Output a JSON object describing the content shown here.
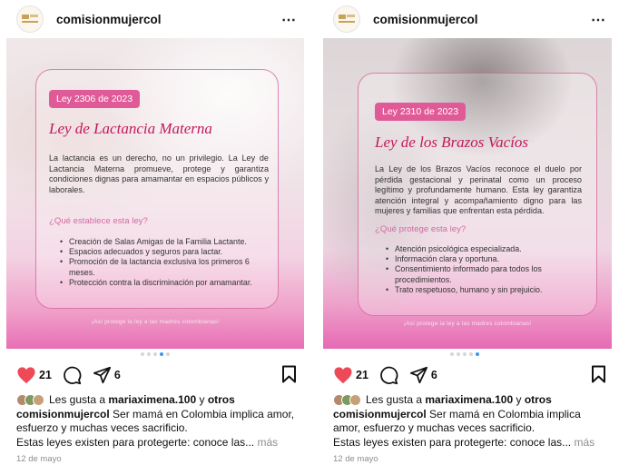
{
  "posts": [
    {
      "username": "comisionmujercol",
      "more_icon": "⋯",
      "card": {
        "badge": "Ley 2306 de 2023",
        "title": "Ley de Lactancia Materna",
        "description": "La lactancia es un derecho, no un privilegio. La Ley de Lactancia Materna promueve, protege y garantiza condiciones dignas para amamantar en espacios públicos y laborales.",
        "question": "¿Qué establece esta ley?",
        "items": [
          "Creación de Salas Amigas de la Familia Lactante.",
          "Espacios adecuados y seguros para lactar.",
          "Promoción de la lactancia exclusiva los primeros 6 meses.",
          "Protección contra la discriminación por amamantar."
        ],
        "footer": "¡Así protege la ley a las madres colombianas!"
      },
      "dots": {
        "total": 6,
        "active": 4
      },
      "likes_count": "21",
      "shares_count": "6",
      "liked_by_prefix": "Les gusta a",
      "liked_by_user": "mariaximena.100",
      "liked_by_and": "y",
      "liked_by_others": "otros",
      "caption_user": "comisionmujercol",
      "caption_text": "Ser mamá en Colombia implica amor, esfuerzo y muchas veces sacrificio.",
      "caption_line2": "Estas leyes existen para protegerte: conoce las...",
      "more_label": "más",
      "date": "12 de mayo"
    },
    {
      "username": "comisionmujercol",
      "more_icon": "⋯",
      "card": {
        "badge": "Ley 2310 de 2023",
        "title": "Ley de los Brazos Vacíos",
        "description": "La Ley de los Brazos Vacíos reconoce el duelo por pérdida gestacional y perinatal como un proceso legítimo y profundamente humano. Esta ley garantiza atención integral y acompañamiento digno para las mujeres y familias que enfrentan esta pérdida.",
        "question": "¿Qué protege esta ley?",
        "items": [
          "Atención psicológica especializada.",
          "Información clara y oportuna.",
          "Consentimiento informado para todos los procedimientos.",
          "Trato respetuoso, humano y sin prejuicio."
        ],
        "footer": "¡Así protege la ley a las madres colombianas!"
      },
      "dots": {
        "total": 5,
        "active": 5
      },
      "likes_count": "21",
      "shares_count": "6",
      "liked_by_prefix": "Les gusta a",
      "liked_by_user": "mariaximena.100",
      "liked_by_and": "y",
      "liked_by_others": "otros",
      "caption_user": "comisionmujercol",
      "caption_text": "Ser mamá en Colombia implica amor, esfuerzo y muchas veces sacrificio.",
      "caption_line2": "Estas leyes existen para protegerte: conoce las...",
      "more_label": "más",
      "date": "12 de mayo"
    }
  ],
  "colors": {
    "heart": "#ed4956",
    "accent": "#e15a98",
    "title": "#c2185b",
    "dot_active": "#3897f0"
  },
  "icons": [
    "heart-icon",
    "comment-icon",
    "share-icon",
    "bookmark-icon",
    "more-options-icon",
    "avatar-logo-icon"
  ]
}
